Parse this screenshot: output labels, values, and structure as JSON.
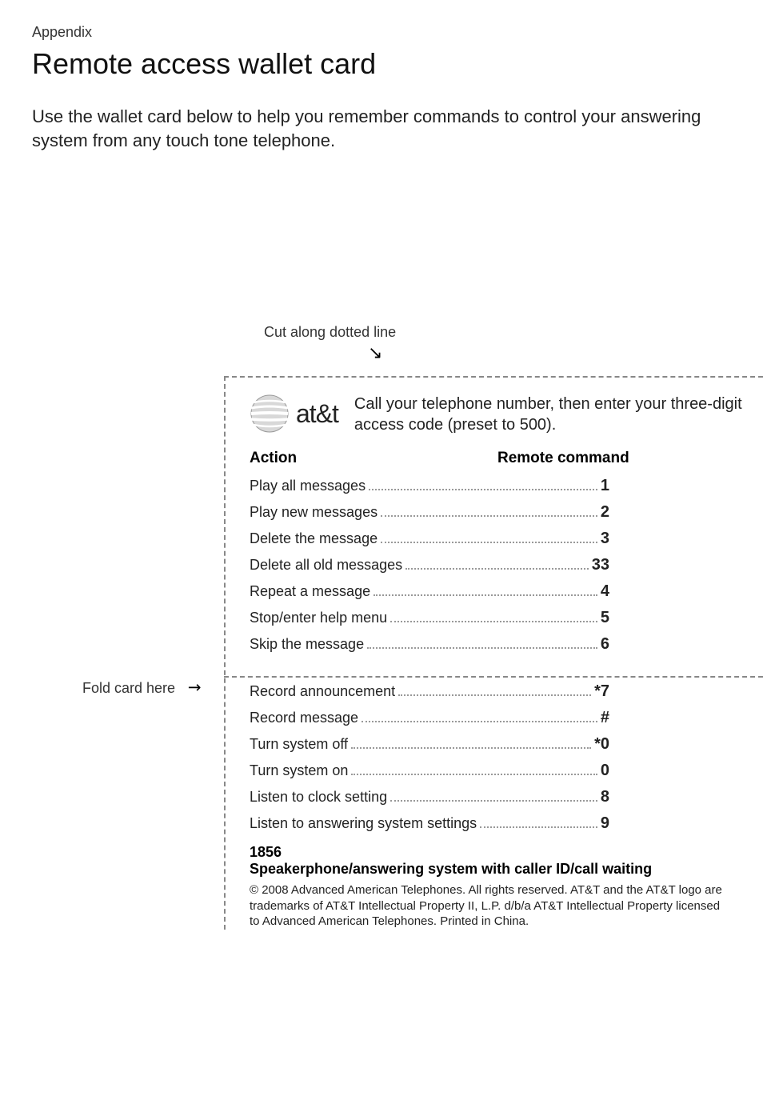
{
  "section_label": "Appendix",
  "title": "Remote access wallet card",
  "intro": "Use the wallet card below to help you remember commands to control your answering system from any touch tone telephone.",
  "cut_label": "Cut along dotted line",
  "fold_label": "Fold card here",
  "logo_text": "at&t",
  "instructions": "Call your telephone number, then enter your three-digit access code (preset to 500).",
  "headers": {
    "action": "Action",
    "command": "Remote command"
  },
  "commands_top": [
    {
      "action": "Play all messages",
      "code": "1"
    },
    {
      "action": "Play new messages",
      "code": "2"
    },
    {
      "action": "Delete the message",
      "code": "3"
    },
    {
      "action": "Delete all old messages",
      "code": "33"
    },
    {
      "action": "Repeat a message",
      "code": "4"
    },
    {
      "action": "Stop/enter help menu",
      "code": "5"
    },
    {
      "action": "Skip the message",
      "code": "6"
    }
  ],
  "commands_bottom": [
    {
      "action": "Record announcement",
      "code": "*7"
    },
    {
      "action": "Record message",
      "code": "#"
    },
    {
      "action": "Turn system off",
      "code": "*0"
    },
    {
      "action": "Turn system on",
      "code": "0"
    },
    {
      "action": "Listen to clock setting",
      "code": "8"
    },
    {
      "action": "Listen to answering system settings",
      "code": "9"
    }
  ],
  "footer": {
    "model": "1856",
    "product": "Speakerphone/answering system with caller ID/call waiting",
    "copyright": "© 2008 Advanced American Telephones. All rights reserved. AT&T and the AT&T logo are trademarks of AT&T Intellectual Property II, L.P. d/b/a AT&T Intellectual Property licensed to Advanced American Telephones. Printed in China."
  }
}
